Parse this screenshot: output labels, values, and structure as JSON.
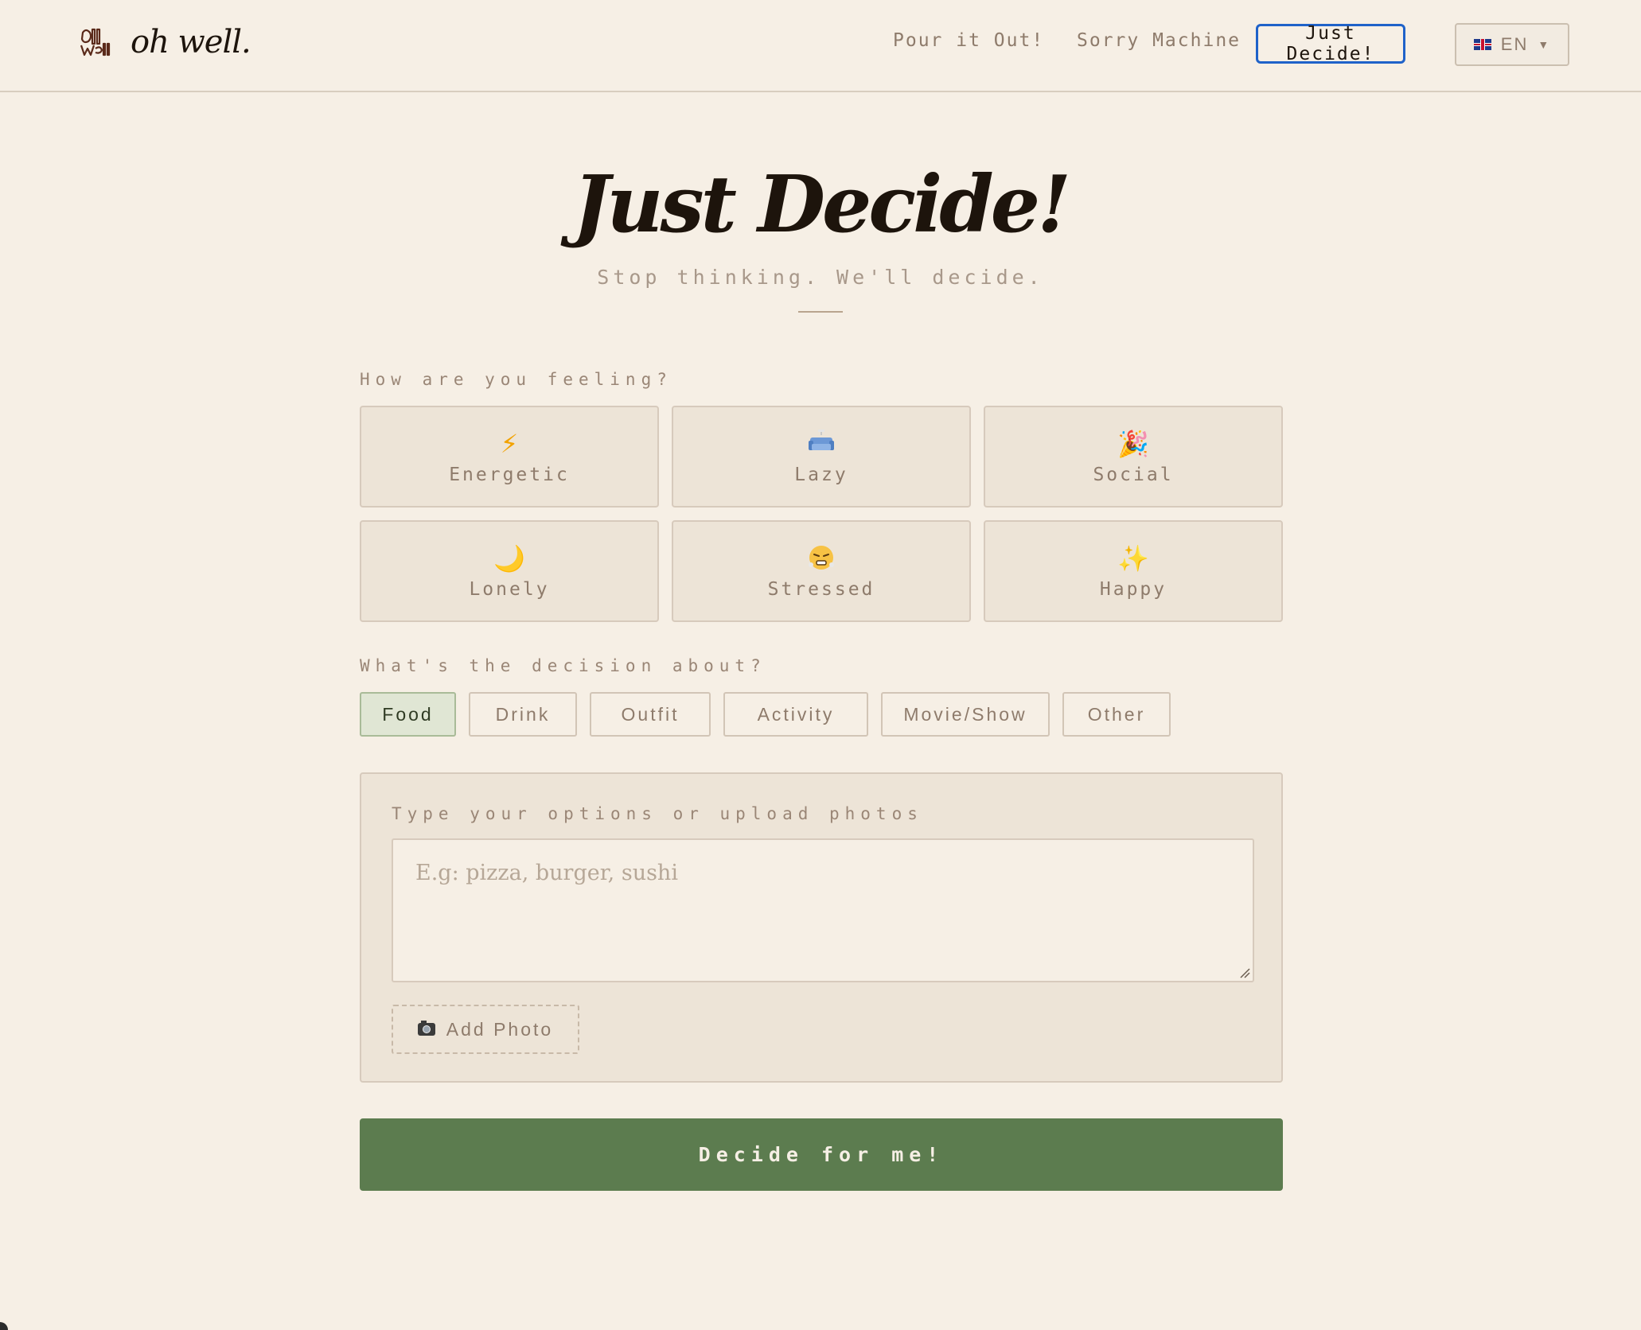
{
  "header": {
    "brand": "oh well.",
    "nav": [
      {
        "label": "Pour it Out!"
      },
      {
        "label": "Sorry Machine"
      },
      {
        "label": "Just Decide!"
      }
    ],
    "language": {
      "code": "EN"
    }
  },
  "hero": {
    "title": "Just Decide!",
    "subtitle": "Stop thinking. We'll decide."
  },
  "mood_section": {
    "label": "How are you feeling?",
    "moods": [
      {
        "label": "Energetic",
        "icon": "lightning-icon",
        "glyph": "⚡"
      },
      {
        "label": "Lazy",
        "icon": "couch-icon",
        "glyph": "🛋"
      },
      {
        "label": "Social",
        "icon": "party-popper-icon",
        "glyph": "🎉"
      },
      {
        "label": "Lonely",
        "icon": "crescent-moon-icon",
        "glyph": "🌙"
      },
      {
        "label": "Stressed",
        "icon": "steaming-face-icon",
        "glyph": "😤"
      },
      {
        "label": "Happy",
        "icon": "sparkles-icon",
        "glyph": "✨"
      }
    ]
  },
  "decision_section": {
    "label": "What's the decision about?",
    "categories": [
      {
        "label": "Food",
        "selected": true
      },
      {
        "label": "Drink",
        "selected": false
      },
      {
        "label": "Outfit",
        "selected": false
      },
      {
        "label": "Activity",
        "selected": false
      },
      {
        "label": "Movie/Show",
        "selected": false
      },
      {
        "label": "Other",
        "selected": false
      }
    ]
  },
  "options": {
    "label": "Type your options or upload photos",
    "placeholder": "E.g: pizza, burger, sushi",
    "value": "",
    "add_photo_label": "Add Photo"
  },
  "submit": {
    "label": "Decide for me!"
  },
  "colors": {
    "background": "#f6efe5",
    "card": "#ede4d7",
    "accent_green": "#5c7c4f",
    "selected_chip": "#e0e6d4",
    "focus_blue": "#1f62c9",
    "text_dark": "#1d140c",
    "text_muted": "#8e7b6b"
  }
}
